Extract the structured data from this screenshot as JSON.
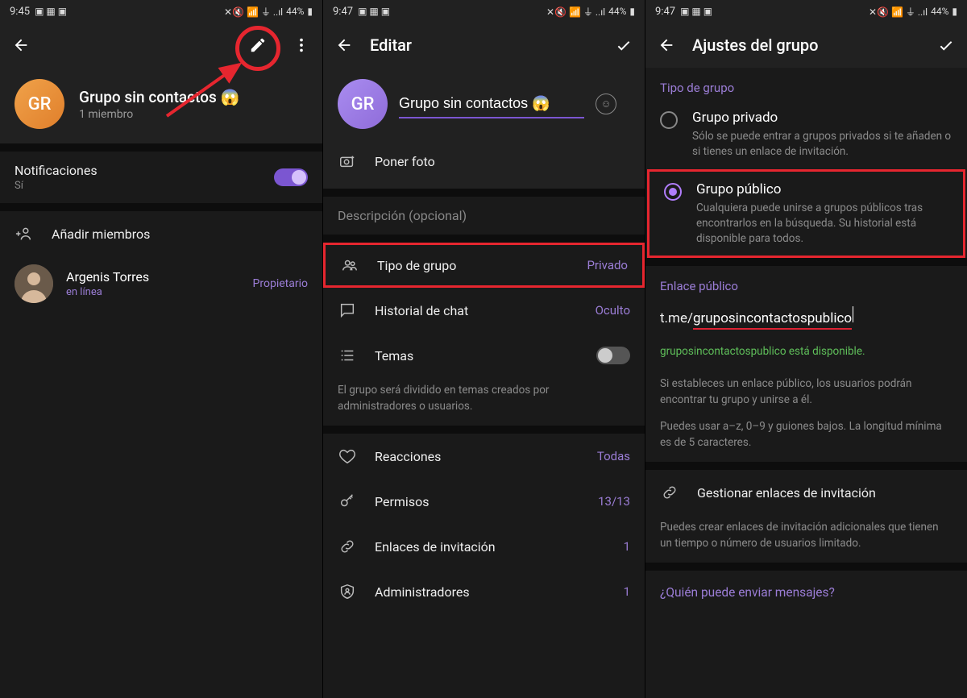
{
  "status": {
    "time1": "9:45",
    "time2": "9:47",
    "time3": "9:47",
    "battery": "44%"
  },
  "screen1": {
    "avatar_initials": "GR",
    "group_name": "Grupo sin contactos 😱",
    "member_count": "1 miembro",
    "notif_label": "Notificaciones",
    "notif_value": "Sí",
    "add_members": "Añadir miembros",
    "member_name": "Argenis Torres",
    "member_status": "en línea",
    "member_role": "Propietario"
  },
  "screen2": {
    "title": "Editar",
    "avatar_initials": "GR",
    "name_value": "Grupo sin contactos 😱",
    "set_photo": "Poner foto",
    "description_placeholder": "Descripción (opcional)",
    "type_label": "Tipo de grupo",
    "type_value": "Privado",
    "history_label": "Historial de chat",
    "history_value": "Oculto",
    "themes_label": "Temas",
    "themes_hint": "El grupo será dividido en temas creados por administradores o usuarios.",
    "reactions_label": "Reacciones",
    "reactions_value": "Todas",
    "permissions_label": "Permisos",
    "permissions_value": "13/13",
    "invites_label": "Enlaces de invitación",
    "invites_value": "1",
    "admins_label": "Administradores",
    "admins_value": "1"
  },
  "screen3": {
    "title": "Ajustes del grupo",
    "section_type": "Tipo de grupo",
    "private_label": "Grupo privado",
    "private_desc": "Sólo se puede entrar a grupos privados si te añaden o si tienes un enlace de invitación.",
    "public_label": "Grupo público",
    "public_desc": "Cualquiera puede unirse a grupos públicos tras encontrarlos en la búsqueda. Su historial está disponible para todos.",
    "section_link": "Enlace público",
    "link_prefix": "t.me/",
    "link_value": "gruposincontactospublico",
    "available_text": "gruposincontactospublico está disponible.",
    "link_hint1": "Si estableces un enlace público, los usuarios podrán encontrar tu grupo y unirse a él.",
    "link_hint2": "Puedes usar a–z, 0–9 y guiones bajos. La longitud mínima es de 5 caracteres.",
    "manage_links": "Gestionar enlaces de invitación",
    "manage_hint": "Puedes crear enlaces de invitación adicionales que tienen un tiempo o número de usuarios limitado.",
    "who_can_send": "¿Quién puede enviar mensajes?"
  }
}
